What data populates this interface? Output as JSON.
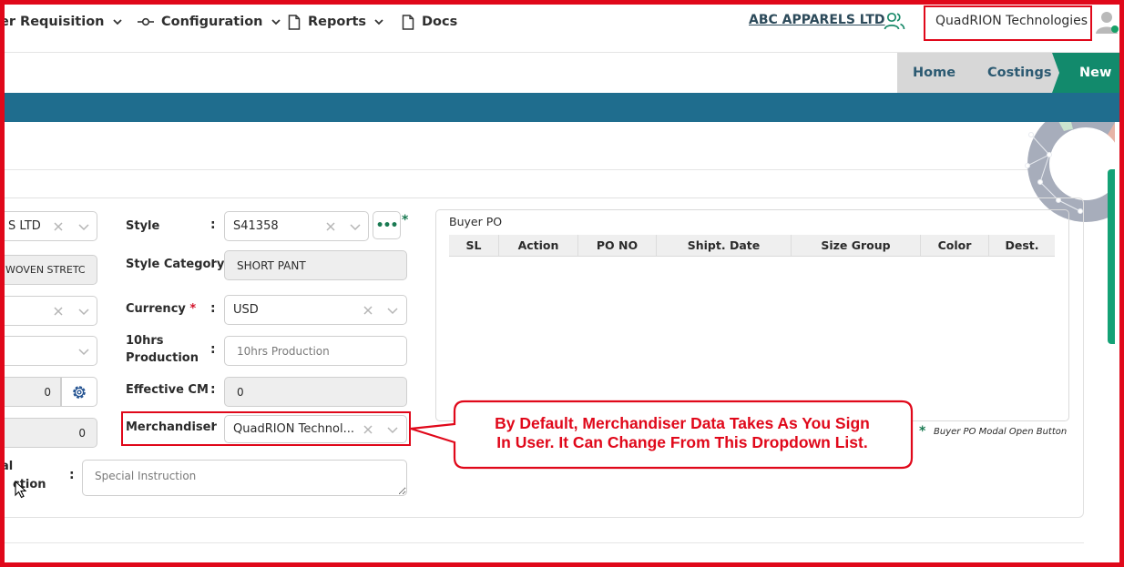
{
  "nav": {
    "items": [
      {
        "label": "er Requisition",
        "icon": "chevron-down-icon"
      },
      {
        "label": "Configuration",
        "icon": "config-icon"
      },
      {
        "label": "Reports",
        "icon": "document-icon"
      },
      {
        "label": "Docs",
        "icon": "document-icon"
      }
    ],
    "company": "ABC APPARELS LTD",
    "user": "QuadRION Technologies"
  },
  "breadcrumb": [
    "Home",
    "Costings",
    "New"
  ],
  "colors": {
    "accent": "#1f6d8e",
    "active": "#128a6c",
    "annotation": "#e0081a"
  },
  "form": {
    "left_col": {
      "buyer_value": "S LTD",
      "category_value": "WOVEN STRETC",
      "numeric_value": "0",
      "numeric_value2": "0",
      "special_label_line1": "al",
      "special_label_line2": "ction",
      "special_placeholder": "Special Instruction"
    },
    "style": {
      "label": "Style",
      "value": "S41358"
    },
    "style_category": {
      "label": "Style Category",
      "value": "SHORT PANT"
    },
    "currency": {
      "label": "Currency",
      "required": "*",
      "value": "USD"
    },
    "production": {
      "label_line1": "10hrs",
      "label_line2": "Production",
      "placeholder": "10hrs Production"
    },
    "effective_cm": {
      "label": "Effective CM",
      "value": "0"
    },
    "merchandiser": {
      "label": "Merchandiser",
      "value": "QuadRION Technol..."
    }
  },
  "buyer_po": {
    "title": "Buyer PO",
    "columns": [
      "SL",
      "Action",
      "PO NO",
      "Shipt. Date",
      "Size Group",
      "Color",
      "Dest."
    ],
    "note": "Buyer PO Modal Open Button"
  },
  "callout": {
    "line1": "By Default, Merchandiser  Data Takes As You Sign",
    "line2": "In User. It Can Change From This Dropdown List."
  }
}
